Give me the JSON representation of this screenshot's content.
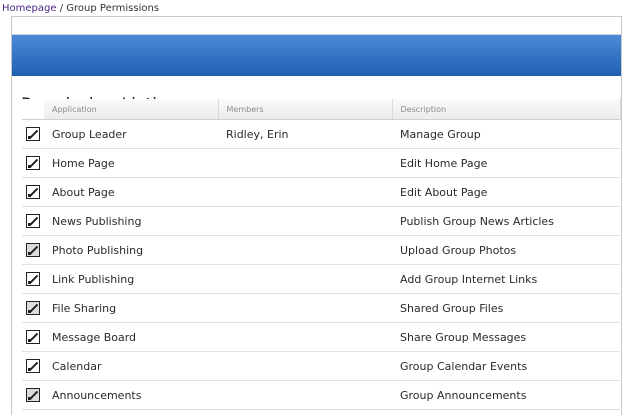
{
  "breadcrumb": {
    "home": "Homepage",
    "separator": "/",
    "current": "Group Permissions"
  },
  "section_title": "Permission Listings",
  "columns": {
    "application": "Application",
    "members": "Members",
    "description": "Description"
  },
  "rows": [
    {
      "application": "Group Leader",
      "members": "Ridley, Erin",
      "description": "Manage Group"
    },
    {
      "application": "Home Page",
      "members": "",
      "description": "Edit Home Page"
    },
    {
      "application": "About Page",
      "members": "",
      "description": "Edit About Page"
    },
    {
      "application": "News Publishing",
      "members": "",
      "description": "Publish Group News Articles"
    },
    {
      "application": "Photo Publishing",
      "members": "",
      "description": "Upload Group Photos"
    },
    {
      "application": "Link Publishing",
      "members": "",
      "description": "Add Group Internet Links"
    },
    {
      "application": "File Sharing",
      "members": "",
      "description": "Shared Group Files"
    },
    {
      "application": "Message Board",
      "members": "",
      "description": "Share Group Messages"
    },
    {
      "application": "Calendar",
      "members": "",
      "description": "Group Calendar Events"
    },
    {
      "application": "Announcements",
      "members": "",
      "description": "Group Announcements"
    }
  ],
  "icons": {
    "row_action": "edit-icon"
  },
  "colors": {
    "header_bar": "#1f5fb0",
    "link": "#4b2a8a"
  }
}
